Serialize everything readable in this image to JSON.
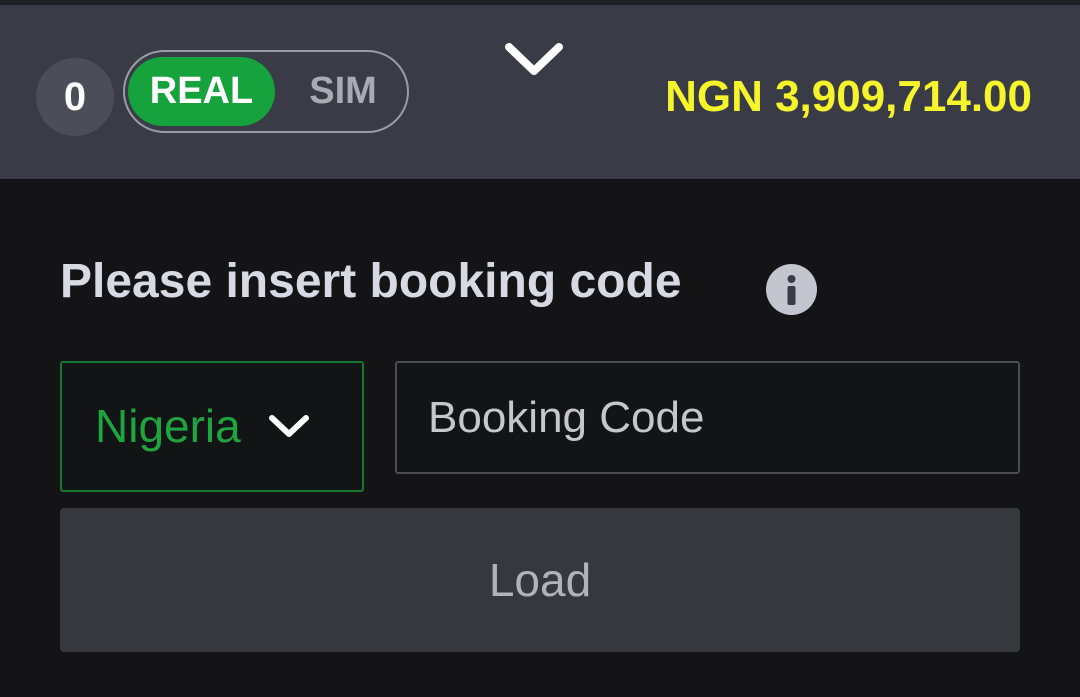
{
  "header": {
    "counter": "0",
    "mode_toggle": {
      "real_label": "REAL",
      "sim_label": "SIM",
      "selected": "REAL"
    },
    "expand_icon": "chevron-down-icon",
    "balance": "NGN 3,909,714.00"
  },
  "booking": {
    "title": "Please insert booking code",
    "info_icon": "info-icon",
    "country_select": {
      "value": "Nigeria",
      "icon": "chevron-down-icon"
    },
    "code_input": {
      "value": "",
      "placeholder": "Booking Code"
    },
    "load_label": "Load"
  },
  "colors": {
    "header_bg": "#393c46",
    "page_bg": "#141416",
    "accent_green": "#16a23c",
    "balance_yellow": "#f6f42a",
    "button_bg": "#37383e"
  }
}
